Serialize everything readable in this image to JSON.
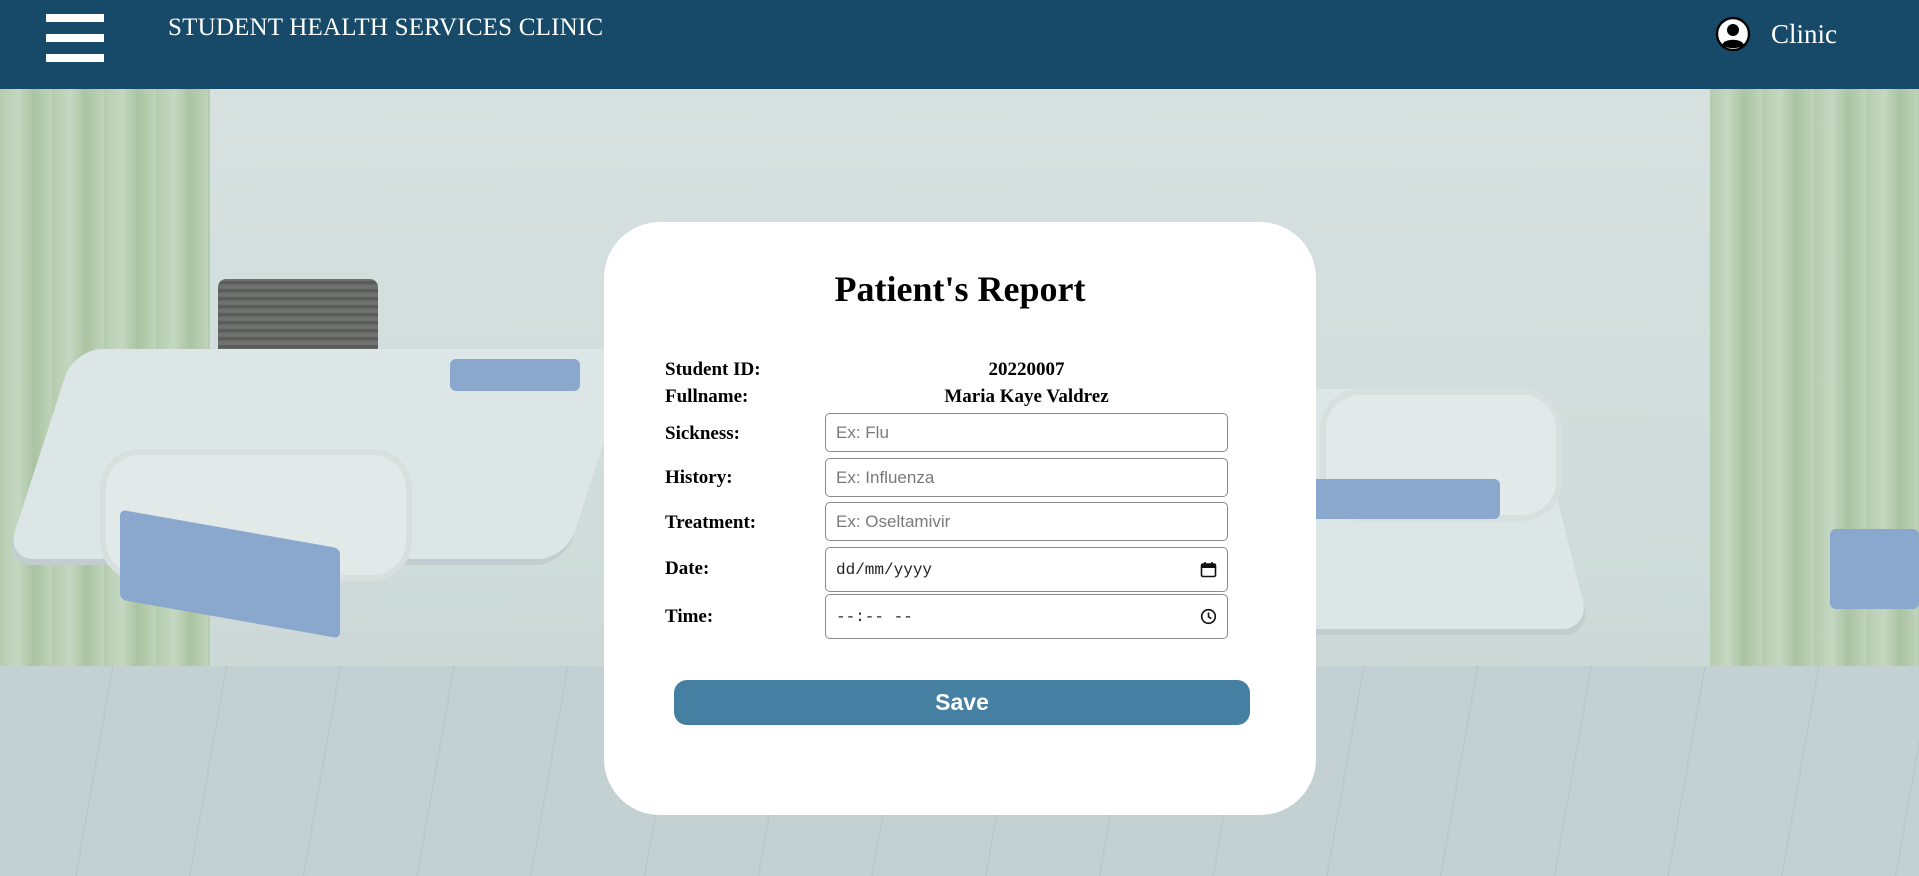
{
  "header": {
    "title": "STUDENT HEALTH SERVICES CLINIC",
    "user_label": "Clinic",
    "menu_icon": "hamburger-menu-icon",
    "user_icon": "user-circle-icon",
    "background_color": "#174a68"
  },
  "form": {
    "title": "Patient's Report",
    "student_id": {
      "label": "Student ID:",
      "value": "20220007"
    },
    "fullname": {
      "label": "Fullname:",
      "value": "Maria Kaye Valdrez"
    },
    "sickness": {
      "label": "Sickness:",
      "placeholder": "Ex: Flu",
      "value": ""
    },
    "history": {
      "label": "History:",
      "placeholder": "Ex: Influenza",
      "value": ""
    },
    "treatment": {
      "label": "Treatment:",
      "placeholder": "Ex: Oseltamivir",
      "value": ""
    },
    "date": {
      "label": "Date:",
      "display": "dd/mm/yyyy",
      "icon": "calendar-icon"
    },
    "time": {
      "label": "Time:",
      "display": "--:-- --",
      "icon": "clock-icon"
    },
    "save_label": "Save",
    "button_color": "#457fa2"
  }
}
